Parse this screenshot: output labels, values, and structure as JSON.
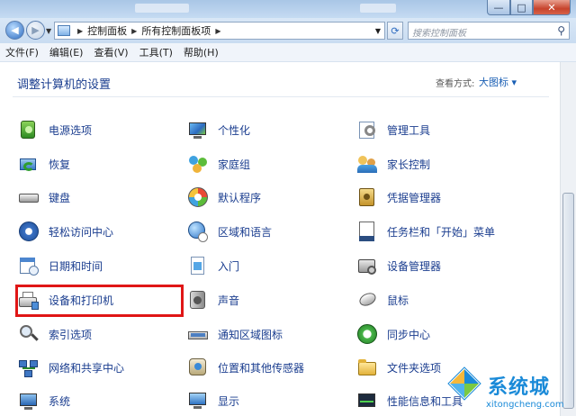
{
  "window": {
    "caption": {
      "minimize": "—",
      "maximize": "□",
      "close": "✕"
    }
  },
  "address": {
    "crumbs": [
      "控制面板",
      "所有控制面板项"
    ],
    "search_placeholder": "搜索控制面板"
  },
  "menu": [
    "文件(F)",
    "编辑(E)",
    "查看(V)",
    "工具(T)",
    "帮助(H)"
  ],
  "header": {
    "title": "调整计算机的设置",
    "view_by_label": "查看方式:",
    "view_by_value": "大图标 ▾"
  },
  "items": {
    "col1": [
      "电源选项",
      "恢复",
      "键盘",
      "轻松访问中心",
      "日期和时间",
      "设备和打印机",
      "索引选项",
      "网络和共享中心",
      "系统"
    ],
    "col2": [
      "个性化",
      "家庭组",
      "默认程序",
      "区域和语言",
      "入门",
      "声音",
      "通知区域图标",
      "位置和其他传感器",
      "显示"
    ],
    "col3": [
      "管理工具",
      "家长控制",
      "凭据管理器",
      "任务栏和「开始」菜单",
      "设备管理器",
      "鼠标",
      "同步中心",
      "文件夹选项",
      "性能信息和工具"
    ]
  },
  "highlighted_item": "设备和打印机",
  "watermark": {
    "title": "系统城",
    "url": "xitongcheng.com"
  },
  "colors": {
    "link": "#1a3d8f",
    "highlight": "#e01616",
    "accent": "#1a8ad8"
  }
}
